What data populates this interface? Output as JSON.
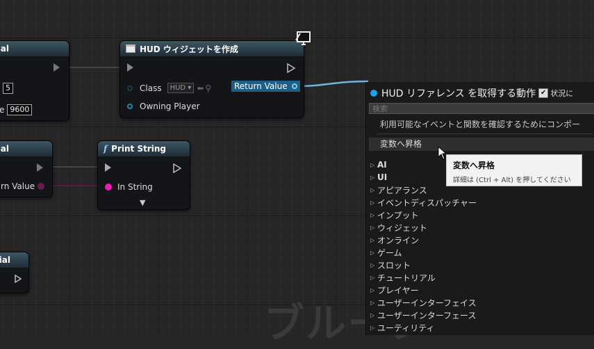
{
  "watermark": "ブループ",
  "node_left1": {
    "title": "ial",
    "value1": "5",
    "label2": "e",
    "value2": "9600"
  },
  "node_left2": {
    "title": "al",
    "pin_label": "rn Value"
  },
  "node_left3": {
    "title": "ial"
  },
  "node_hud": {
    "title": "HUD ウィジェットを作成",
    "class_label": "Class",
    "class_value": "HUD",
    "owning_label": "Owning Player",
    "return_label": "Return Value"
  },
  "node_print": {
    "title": "Print String",
    "in_string_label": "In String"
  },
  "panel": {
    "title": "HUD リファレンス を取得する動作",
    "context_label": "状況に",
    "search_placeholder": "検索",
    "hint": "利用可能なイベントと関数を確認するためにコンポー",
    "promote": "変数へ昇格",
    "categories": [
      {
        "label": "AI",
        "bold": true
      },
      {
        "label": "UI",
        "bold": true
      },
      {
        "label": "アピアランス"
      },
      {
        "label": "イベントディスパッチャー"
      },
      {
        "label": "インプット"
      },
      {
        "label": "ウィジェット"
      },
      {
        "label": "オンライン"
      },
      {
        "label": "ゲーム"
      },
      {
        "label": "スロット"
      },
      {
        "label": "チュートリアル"
      },
      {
        "label": "プレイヤー"
      },
      {
        "label": "ユーザーインターフェイス"
      },
      {
        "label": "ユーザーインターフェース"
      },
      {
        "label": "ユーティリティ"
      }
    ]
  },
  "tooltip": {
    "title": "変数へ昇格",
    "detail": "詳細は (Ctrl + Alt) を押してください"
  },
  "colors": {
    "accent": "#1aa3e8",
    "string_pin": "#f219b9",
    "object_pin": "#1e8aa8"
  }
}
